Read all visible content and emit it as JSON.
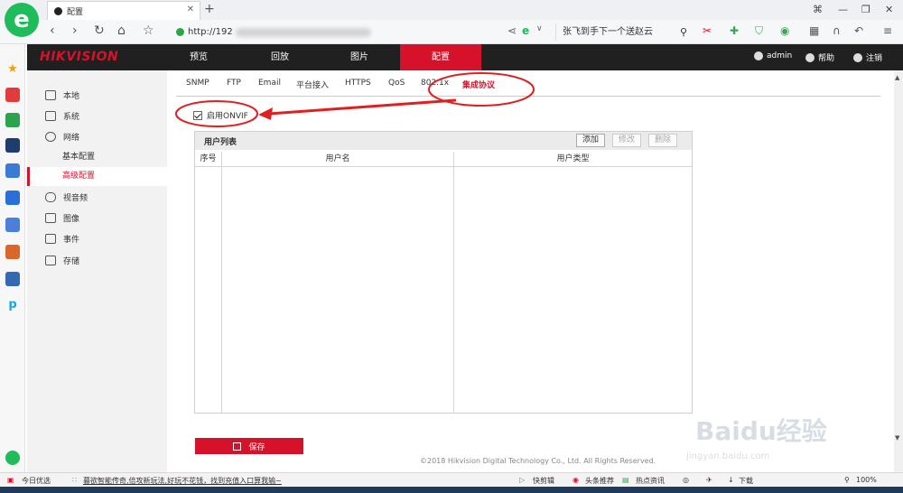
{
  "browser": {
    "tab_title": "配置",
    "url_prefix": "http://192",
    "search_text": "张飞到手下一个送赵云",
    "new_tab": "+",
    "win_controls": [
      "⌐",
      "—",
      "❐",
      "✕"
    ]
  },
  "app": {
    "logo": "HIKVISION",
    "menu": [
      "预览",
      "回放",
      "图片",
      "配置"
    ],
    "active_menu": "配置",
    "user": "admin",
    "help": "帮助",
    "logout": "注销"
  },
  "sidebar": {
    "items": [
      {
        "label": "本地",
        "icon": "monitor-icon"
      },
      {
        "label": "系统",
        "icon": "system-icon"
      },
      {
        "label": "网络",
        "icon": "globe-icon"
      },
      {
        "label": "视音频",
        "icon": "mic-icon"
      },
      {
        "label": "图像",
        "icon": "image-icon"
      },
      {
        "label": "事件",
        "icon": "calendar-icon"
      },
      {
        "label": "存储",
        "icon": "save-icon"
      }
    ],
    "network_sub": [
      "基本配置",
      "高级配置"
    ],
    "active_sub": "高级配置"
  },
  "tabs": [
    "SNMP",
    "FTP",
    "Email",
    "平台接入",
    "HTTPS",
    "QoS",
    "802.1x",
    "集成协议"
  ],
  "active_tab": "集成协议",
  "onvif": {
    "label": "启用ONVIF",
    "checked": true
  },
  "user_list": {
    "title": "用户列表",
    "add": "添加",
    "edit": "修改",
    "delete": "删除",
    "columns": [
      "序号",
      "用户名",
      "用户类型"
    ]
  },
  "save_label": "保存",
  "copyright": "©2018 Hikvision Digital Technology Co., Ltd. All Rights Reserved.",
  "statusbar": {
    "left": "今日优选",
    "news": "暮欲智能传奇,倍攻新玩法,好玩不花钱，找到充值入口算我输~",
    "items": [
      "快剪辑",
      "头条推荐",
      "热点资讯",
      "下载",
      "100%"
    ]
  },
  "watermark": {
    "brand": "Baidu经验",
    "url": "jingyan.baidu.com"
  }
}
